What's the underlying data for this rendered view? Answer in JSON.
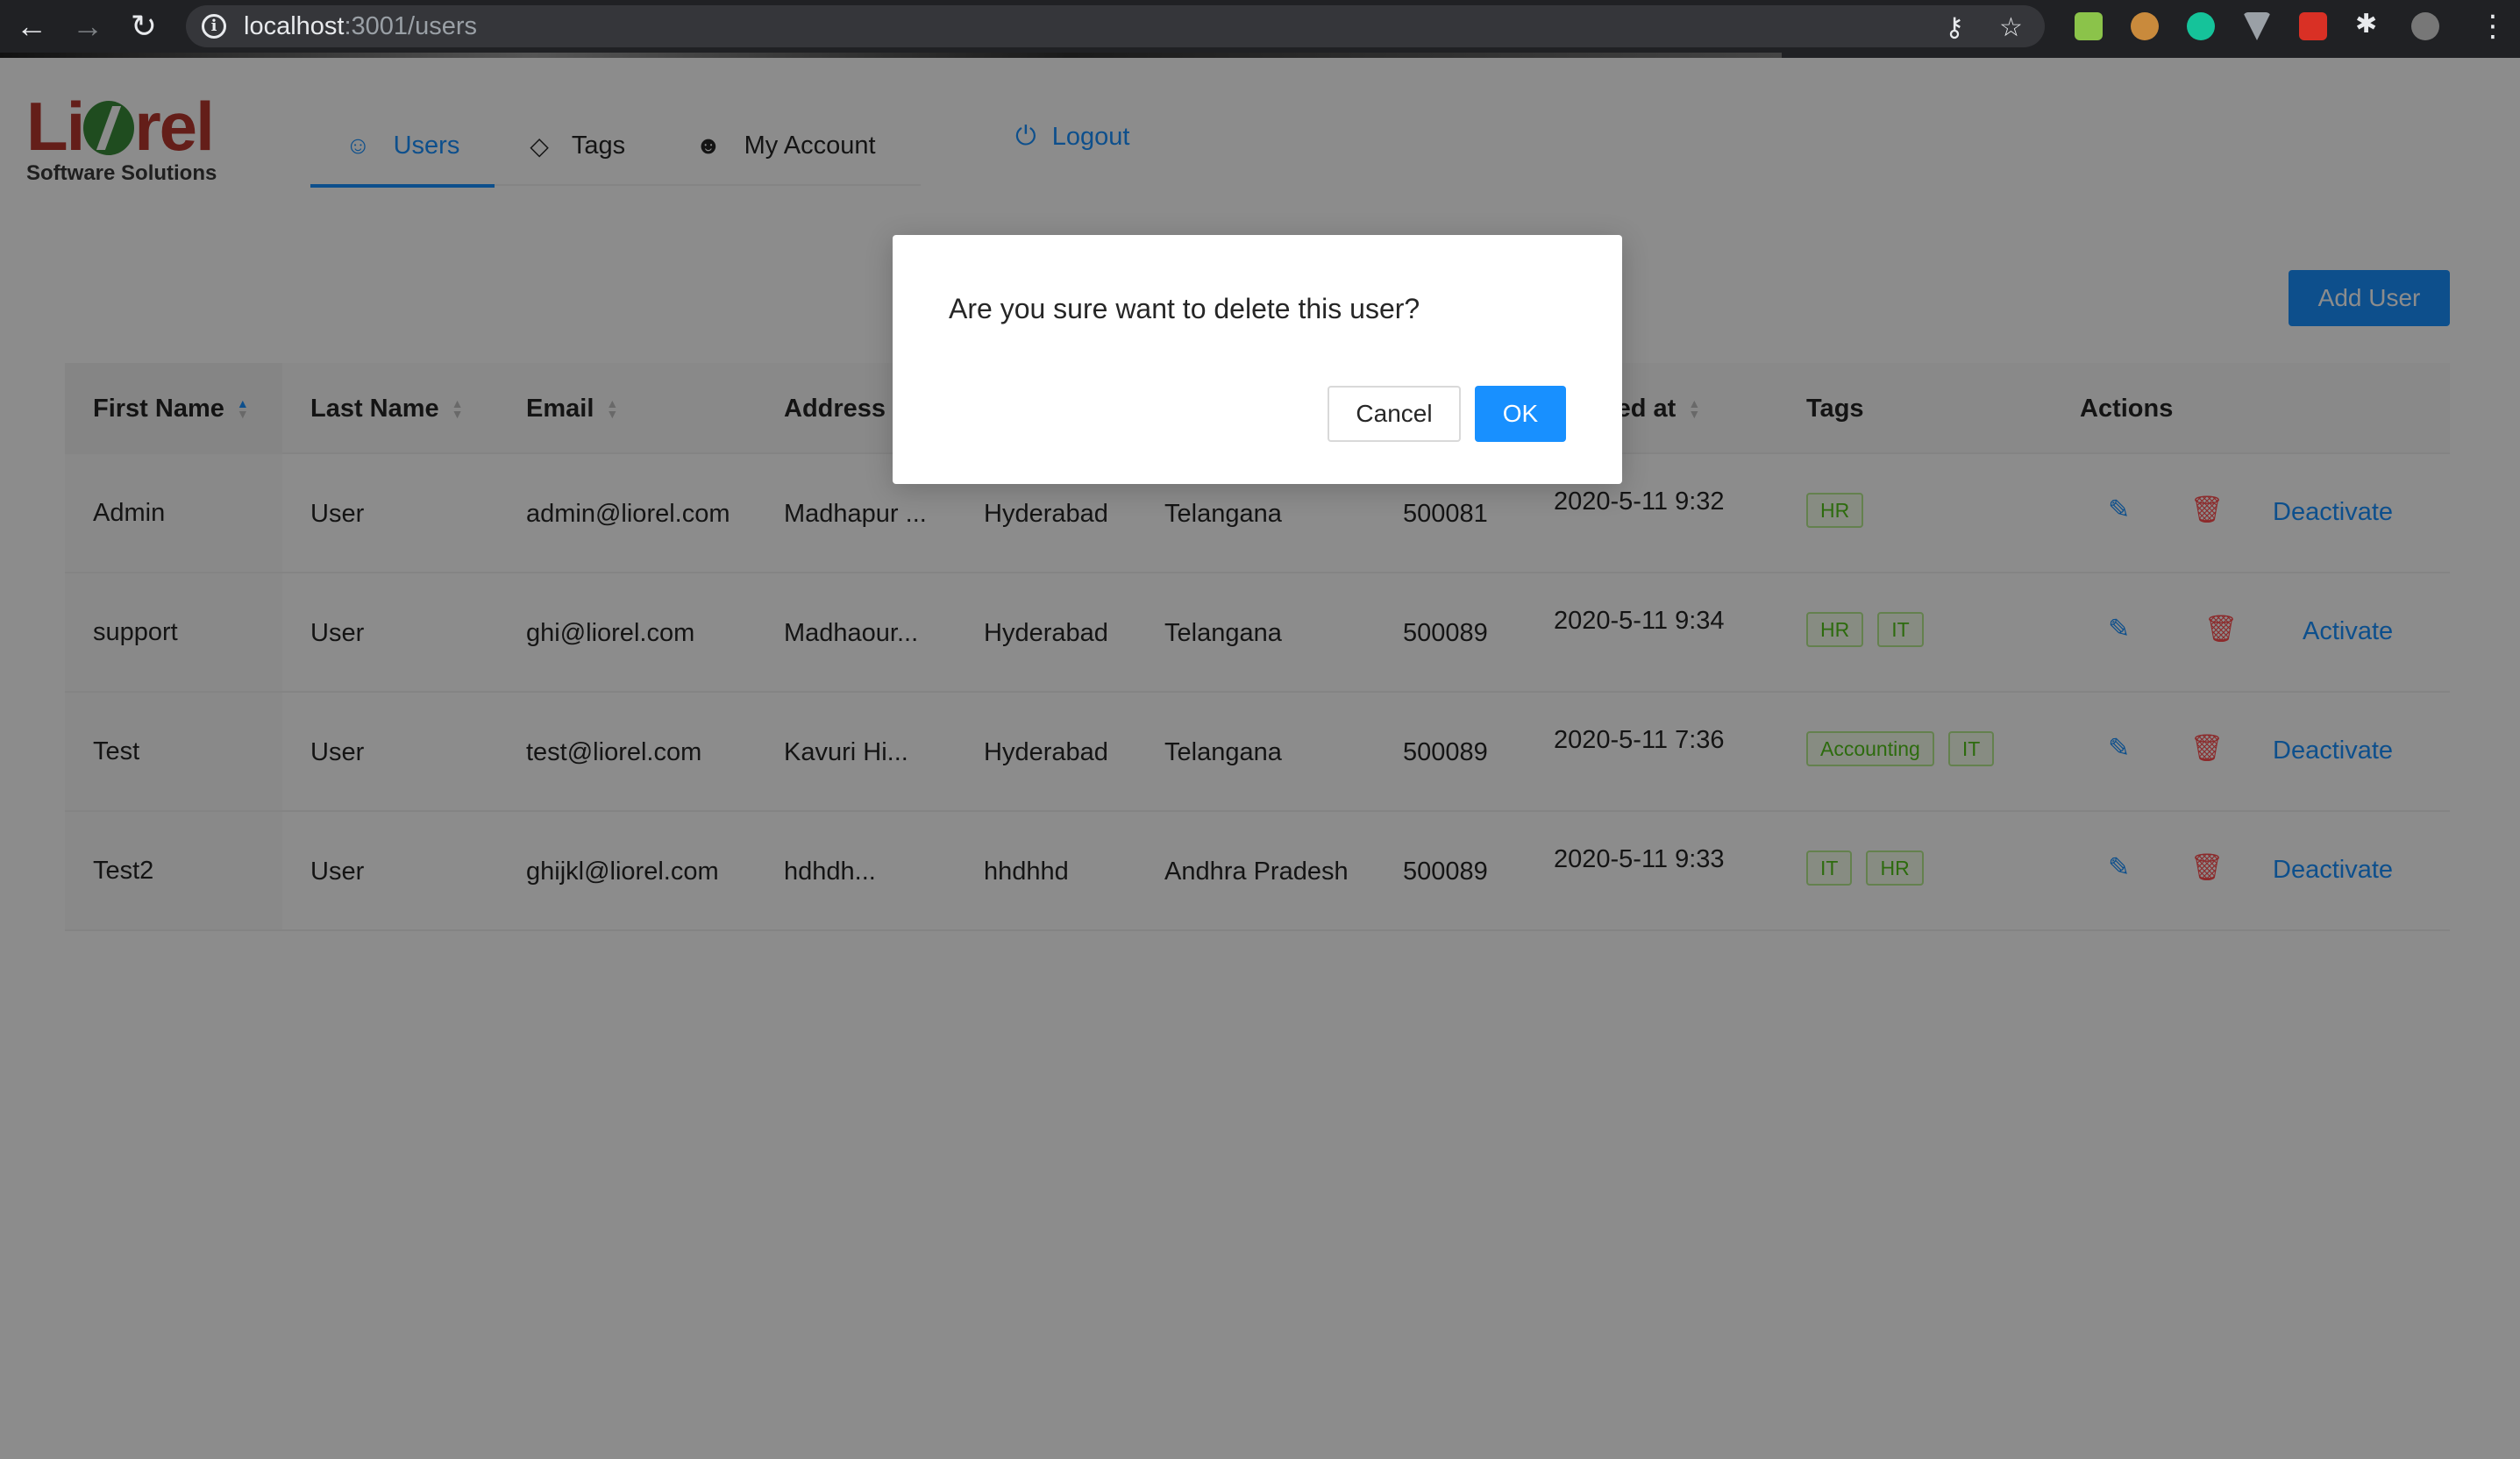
{
  "browser": {
    "url_host": "localhost",
    "url_path": ":3001/users"
  },
  "logo": {
    "word_left": "Li",
    "word_right": "rel",
    "subtitle": "Software Solutions"
  },
  "nav": {
    "items": [
      {
        "label": "Users",
        "icon": "users-icon",
        "active": true
      },
      {
        "label": "Tags",
        "icon": "tag-icon",
        "active": false
      },
      {
        "label": "My Account",
        "icon": "user-icon",
        "active": false
      }
    ],
    "logout": "Logout"
  },
  "toolbar": {
    "add_user": "Add User"
  },
  "table": {
    "columns": [
      "First Name",
      "Last Name",
      "Email",
      "Address",
      "ted at",
      "Tags",
      "Actions"
    ],
    "rows": [
      {
        "first": "Admin",
        "last": "User",
        "email": "admin@liorel.com",
        "address": "Madhapur ...",
        "city": "Hyderabad",
        "state": "Telangana",
        "zip": "500081",
        "created": "2020-5-11 9:32",
        "tags": [
          "HR"
        ],
        "status_action": "Deactivate"
      },
      {
        "first": "support",
        "last": "User",
        "email": "ghi@liorel.com",
        "address": "Madhaour...",
        "city": "Hyderabad",
        "state": "Telangana",
        "zip": "500089",
        "created": "2020-5-11 9:34",
        "tags": [
          "HR",
          "IT"
        ],
        "status_action": "Activate"
      },
      {
        "first": "Test",
        "last": "User",
        "email": "test@liorel.com",
        "address": "Kavuri Hi...",
        "city": "Hyderabad",
        "state": "Telangana",
        "zip": "500089",
        "created": "2020-5-11 7:36",
        "tags": [
          "Accounting",
          "IT"
        ],
        "status_action": "Deactivate"
      },
      {
        "first": "Test2",
        "last": "User",
        "email": "ghijkl@liorel.com",
        "address": "hdhdh...",
        "city": "hhdhhd",
        "state": "Andhra Pradesh",
        "zip": "500089",
        "created": "2020-5-11 9:33",
        "tags": [
          "IT",
          "HR"
        ],
        "status_action": "Deactivate"
      }
    ]
  },
  "modal": {
    "question": "Are you sure want to delete this user?",
    "cancel": "Cancel",
    "ok": "OK"
  },
  "colors": {
    "primary": "#1890ff",
    "danger": "#ff4d4f",
    "tag_green": "#52c41a",
    "logo_red": "#b7372f",
    "logo_green": "#3a8a3a"
  }
}
